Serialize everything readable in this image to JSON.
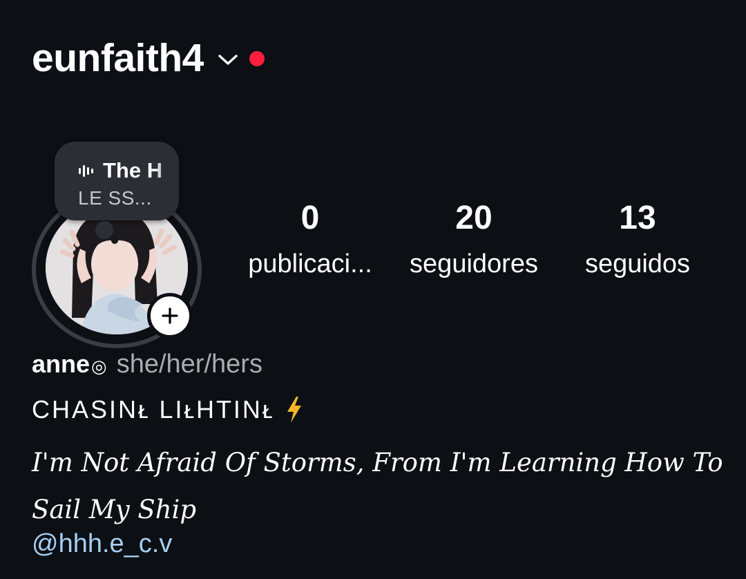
{
  "header": {
    "username": "eunfaith4",
    "account_switcher_icon": "chevron-down-icon",
    "notification_dot_color": "#ff1f3d"
  },
  "note": {
    "music_icon": "audio-bars-icon",
    "title": "The H",
    "subtitle": "LE SS..."
  },
  "profile": {
    "avatar": "profile-photo",
    "add_story_icon": "plus-icon"
  },
  "stats": [
    {
      "count": "0",
      "label": "publicaci..."
    },
    {
      "count": "20",
      "label": "seguidores"
    },
    {
      "count": "13",
      "label": "seguidos"
    }
  ],
  "bio": {
    "display_name": "anne",
    "name_emoji": "◎",
    "pronouns": "she/her/hers",
    "line1": "CHASINᴌ LIᴌHTINᴌ",
    "line1_emoji": "lightning-icon",
    "line2": "I'm Not Afraid Of Storms, From I'm Learning How To Sail My Ship",
    "mention": "@hhh.e_c.v"
  },
  "colors": {
    "background": "#0c0f14",
    "link": "#a5cff5",
    "muted_text": "#a8abb1"
  }
}
